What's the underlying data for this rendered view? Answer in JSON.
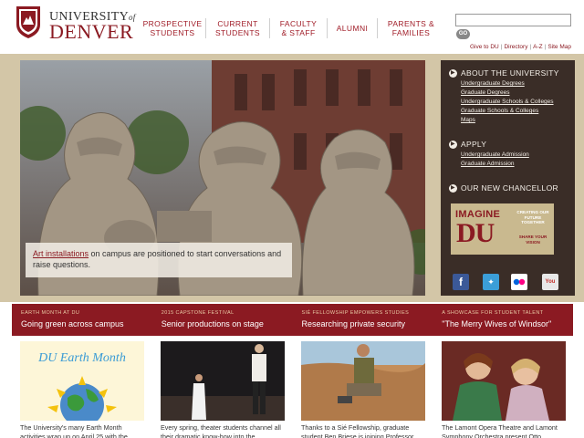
{
  "header": {
    "logo": {
      "line1": "UNIVERSITY",
      "line1_small": "of",
      "line2": "DENVER"
    },
    "nav": [
      {
        "line1": "PROSPECTIVE",
        "line2": "STUDENTS"
      },
      {
        "line1": "CURRENT",
        "line2": "STUDENTS"
      },
      {
        "line1": "FACULTY",
        "line2": "& STAFF"
      },
      {
        "line1": "ALUMNI",
        "line2": ""
      },
      {
        "line1": "PARENTS &",
        "line2": "FAMILIES"
      }
    ],
    "search": {
      "placeholder": "",
      "go_label": "GO"
    },
    "utility": [
      "Give to DU",
      "Directory",
      "A-Z",
      "Site Map"
    ]
  },
  "hero": {
    "caption_link": "Art installations",
    "caption_rest": " on campus are positioned to start conversations and raise questions."
  },
  "sidebar": {
    "about": {
      "title": "ABOUT THE UNIVERSITY",
      "links": [
        "Undergraduate Degrees",
        "Graduate Degrees",
        "Undergraduate Schools & Colleges",
        "Graduate Schools & Colleges",
        "Maps"
      ]
    },
    "apply": {
      "title": "APPLY",
      "links": [
        "Undergraduate Admission",
        "Graduate Admission"
      ]
    },
    "chancellor": {
      "title": "OUR NEW CHANCELLOR"
    },
    "imagine": {
      "word1": "IMAGINE",
      "word2": "DU",
      "tagline": "CREATING OUR FUTURE TOGETHER",
      "share": "SHARE YOUR VISION"
    },
    "social": [
      "facebook-icon",
      "twitter-icon",
      "flickr-icon",
      "youtube-icon"
    ]
  },
  "stories": [
    {
      "kicker": "EARTH MONTH AT DU",
      "headline": "Going green across campus",
      "image_text": "DU Earth Month",
      "text": "The University's many Earth Month activities wrap up on April 25 with the"
    },
    {
      "kicker": "2015 CAPSTONE FESTIVAL",
      "headline": "Senior productions on stage",
      "text": "Every spring, theater students channel all their dramatic know-how into the"
    },
    {
      "kicker": "SIÉ FELLOWSHIP EMPOWERS STUDIES",
      "headline": "Researching private security",
      "text": "Thanks to a Sié Fellowship, graduate student Ben Briese is joining Professor"
    },
    {
      "kicker": "A SHOWCASE FOR STUDENT TALENT",
      "headline": "\"The Merry Wives of Windsor\"",
      "text": "The Lamont Opera Theatre and Lamont Symphony Orchestra present Otto"
    }
  ],
  "colors": {
    "crimson": "#8b1a22",
    "gold": "#d3c6a7",
    "sidebar": "#3a2d27"
  }
}
